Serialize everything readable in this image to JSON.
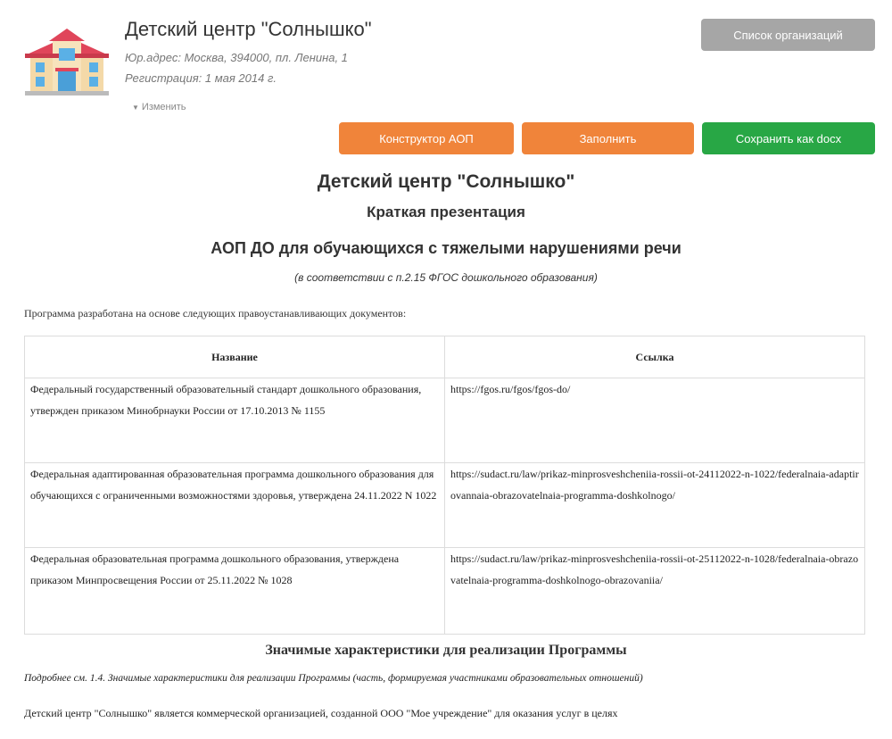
{
  "org": {
    "title": "Детский центр \"Солнышко\"",
    "address": "Юр.адрес: Москва, 394000, пл. Ленина, 1",
    "registration": "Регистрация: 1 мая 2014 г.",
    "edit_label": "Изменить",
    "logo_icon": "building-icon"
  },
  "toolbar": {
    "org_list_label": "Список организаций",
    "constructor_label": "Конструктор АОП",
    "fill_label": "Заполнить",
    "save_docx_label": "Сохранить как docx",
    "colors": {
      "grey": "#a6a6a6",
      "orange": "#f0843a",
      "green": "#28a745"
    }
  },
  "document": {
    "title": "Детский центр \"Солнышко\"",
    "subtitle": "Краткая презентация",
    "program_title": "АОП ДО для обучающихся с тяжелыми нарушениями речи",
    "program_note": "(в соответствии с п.2.15 ФГОС дошкольного образования)",
    "intro": "Программа разработана на основе следующих правоустанавливающих документов:",
    "table": {
      "headers": [
        "Название",
        "Ссылка"
      ],
      "rows": [
        {
          "name": "Федеральный государственный образовательный стандарт дошкольного образования, утвержден приказом Минобрнауки России от 17.10.2013 № 1155",
          "link": "https://fgos.ru/fgos/fgos-do/"
        },
        {
          "name": "Федеральная адаптированная образовательная программа дошкольного образования для обучающихся с ограниченными возможностями здоровья, утверждена 24.11.2022 N 1022",
          "link": "https://sudact.ru/law/prikaz-minprosveshcheniia-rossii-ot-24112022-n-1022/federalnaia-adaptirovannaia-obrazovatelnaia-programma-doshkolnogo/"
        },
        {
          "name": "Федеральная образовательная программа дошкольного образования, утверждена приказом Минпросвещения России от 25.11.2022 № 1028",
          "link": "https://sudact.ru/law/prikaz-minprosveshcheniia-rossii-ot-25112022-n-1028/federalnaia-obrazovatelnaia-programma-doshkolnogo-obrazovaniia/"
        }
      ]
    },
    "section_title": "Значимые характеристики для реализации Программы",
    "section_note": "Подробнее см. 1.4. Значимые характеристики для реализации Программы (часть, формируемая участниками образовательных отношений)",
    "paragraph": "Детский центр \"Солнышко\" является коммерческой организацией, созданной ООО \"Мое учреждение\" для оказания услуг в целях"
  }
}
